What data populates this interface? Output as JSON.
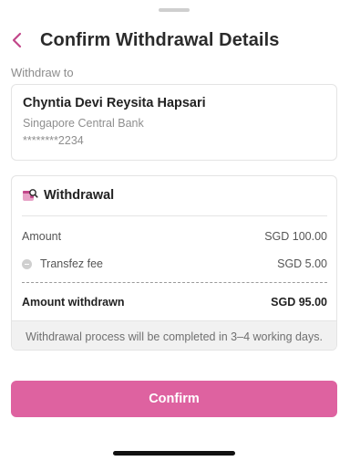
{
  "header": {
    "title": "Confirm Withdrawal Details",
    "back_icon": "chevron-left-icon",
    "accent_color": "#c2478a"
  },
  "recipient": {
    "label": "Withdraw to",
    "name": "Chyntia Devi Reysita Hapsari",
    "bank": "Singapore Central Bank",
    "account": "********2234"
  },
  "withdrawal": {
    "title": "Withdrawal",
    "icon": "wallet-search-icon",
    "amount_label": "Amount",
    "amount_value": "SGD 100.00",
    "fee_label": "Transfez fee",
    "fee_icon": "minus-circle-icon",
    "fee_value": "SGD 5.00",
    "total_label": "Amount withdrawn",
    "total_value": "SGD 95.00",
    "note": "Withdrawal process will be completed in 3–4 working days."
  },
  "actions": {
    "confirm_label": "Confirm",
    "confirm_color": "#de62a0"
  }
}
